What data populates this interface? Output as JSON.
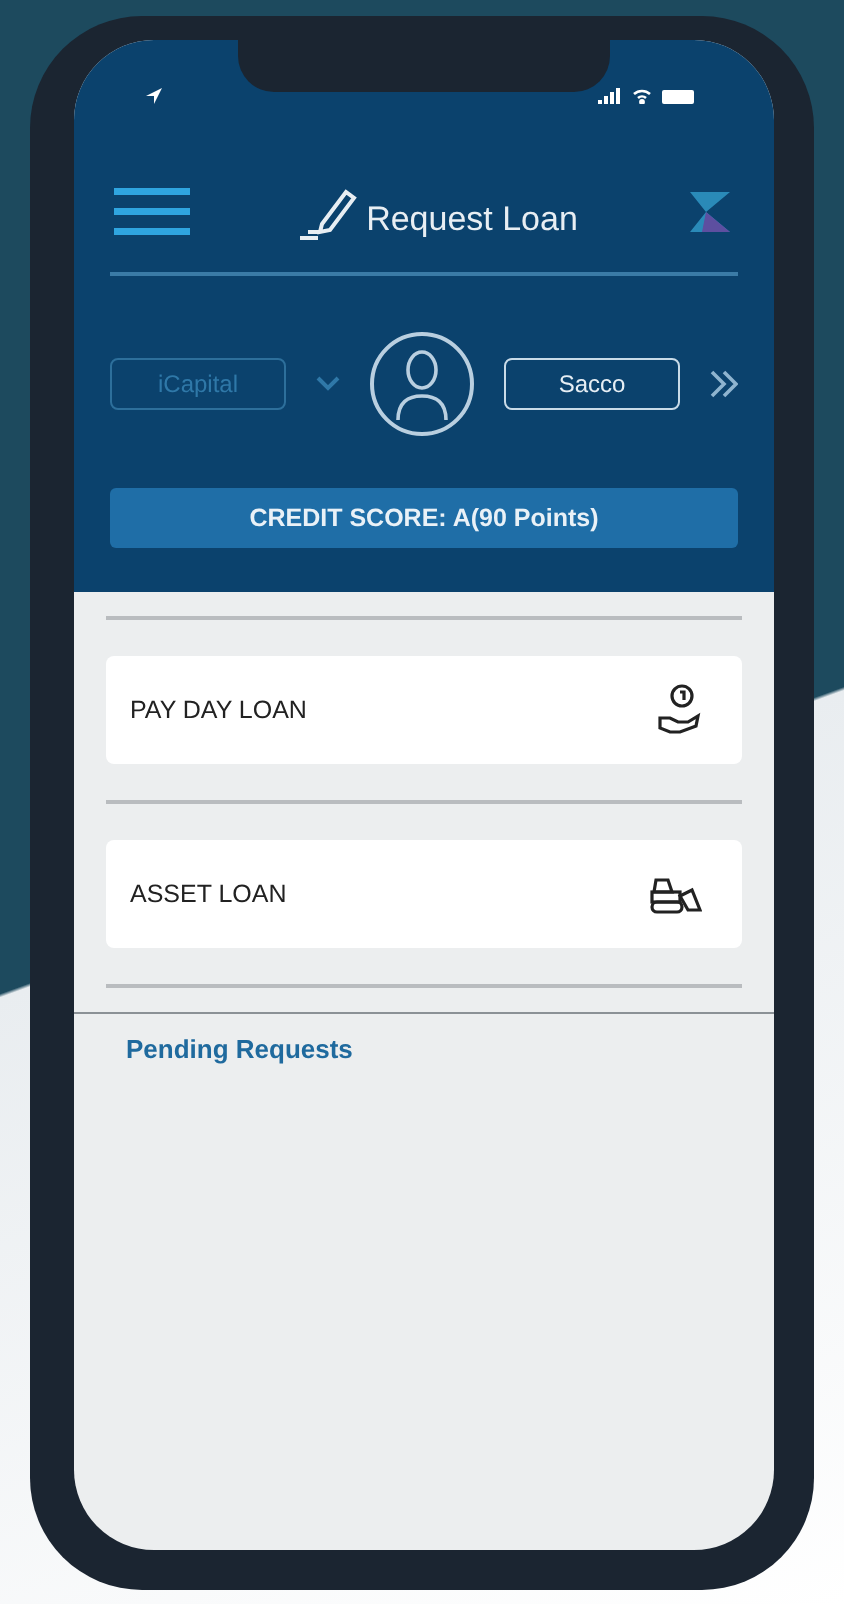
{
  "header": {
    "title": "Request Loan"
  },
  "accounts": [
    {
      "label": "iCapital",
      "selected": false
    },
    {
      "label": "Sacco",
      "selected": true
    }
  ],
  "credit_score": "CREDIT SCORE: A(90 Points)",
  "loan_types": [
    {
      "label": "PAY DAY LOAN",
      "kind": "payday"
    },
    {
      "label": "ASSET LOAN",
      "kind": "asset"
    }
  ],
  "pending": {
    "title": "Pending Requests"
  }
}
